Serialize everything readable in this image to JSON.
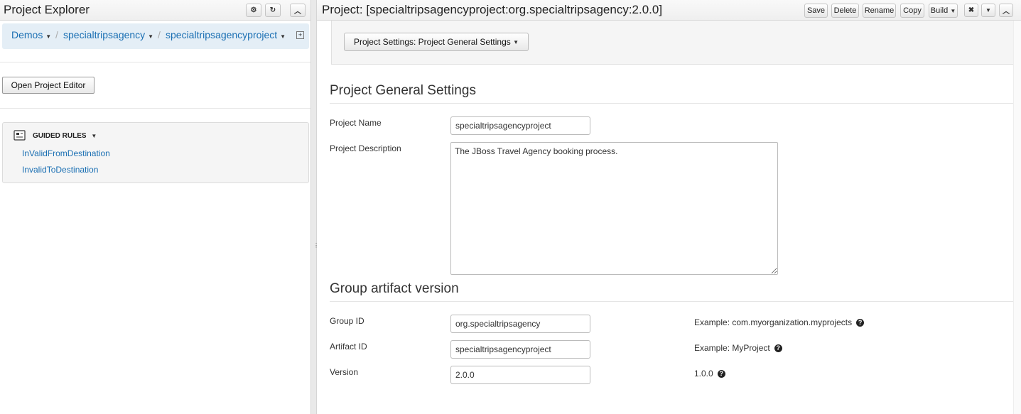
{
  "explorer": {
    "title": "Project Explorer",
    "breadcrumb": [
      "Demos",
      "specialtripsagency",
      "specialtripsagencyproject"
    ],
    "open_editor_label": "Open Project Editor",
    "guided_rules": {
      "title": "GUIDED RULES",
      "items": [
        "InValidFromDestination",
        "InvalidToDestination"
      ]
    }
  },
  "project": {
    "title": "Project: [specialtripsagencyproject:org.specialtripsagency:2.0.0]",
    "toolbar": [
      "Save",
      "Delete",
      "Rename",
      "Copy",
      "Build"
    ],
    "settings_dropdown": "Project Settings: Project General Settings",
    "general": {
      "heading": "Project General Settings",
      "name_label": "Project Name",
      "name_value": "specialtripsagencyproject",
      "desc_label": "Project Description",
      "desc_value": "The JBoss Travel Agency booking process."
    },
    "gav": {
      "heading": "Group artifact version",
      "group_label": "Group ID",
      "group_value": "org.specialtripsagency",
      "group_help": "Example: com.myorganization.myprojects",
      "artifact_label": "Artifact ID",
      "artifact_value": "specialtripsagencyproject",
      "artifact_help": "Example: MyProject",
      "version_label": "Version",
      "version_value": "2.0.0",
      "version_help": "1.0.0"
    }
  },
  "colors": {
    "link": "#1a6fb3",
    "breadcrumb_bg": "#e4eef6"
  },
  "icons": [
    "gear-icon",
    "refresh-icon",
    "collapse-icon",
    "expand-icon",
    "guided-rule-icon",
    "help-icon",
    "close-icon",
    "caret-down-icon"
  ]
}
